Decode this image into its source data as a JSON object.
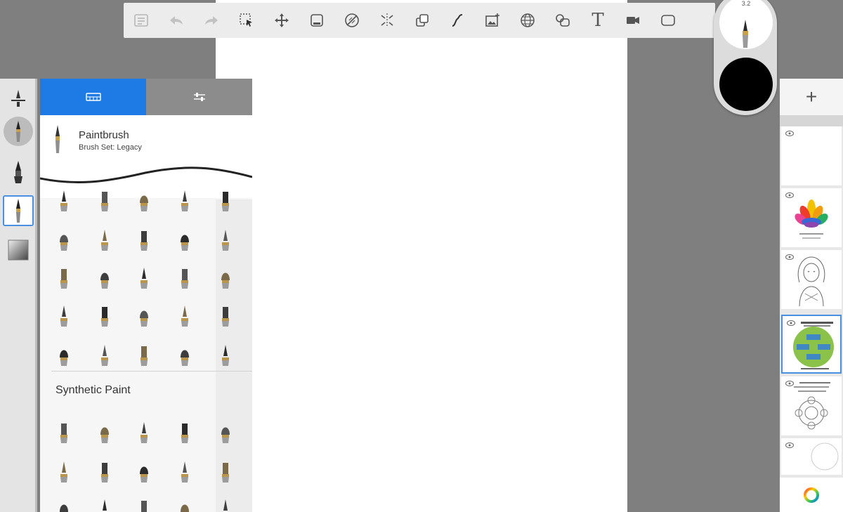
{
  "toolbar": {
    "tools": [
      {
        "id": "lagoon",
        "name": "lagoon-icon",
        "enabled": false
      },
      {
        "id": "undo",
        "name": "undo-icon",
        "enabled": false
      },
      {
        "id": "redo",
        "name": "redo-icon",
        "enabled": false
      },
      {
        "id": "select",
        "name": "selection-icon",
        "enabled": true
      },
      {
        "id": "transform",
        "name": "transform-icon",
        "enabled": true
      },
      {
        "id": "crop",
        "name": "crop-icon",
        "enabled": true
      },
      {
        "id": "ruler",
        "name": "ruler-icon",
        "enabled": true
      },
      {
        "id": "symmetry",
        "name": "symmetry-icon",
        "enabled": true
      },
      {
        "id": "fill",
        "name": "fill-icon",
        "enabled": true
      },
      {
        "id": "curve",
        "name": "curve-icon",
        "enabled": true
      },
      {
        "id": "image",
        "name": "add-image-icon",
        "enabled": true
      },
      {
        "id": "perspective",
        "name": "perspective-guide-icon",
        "enabled": true
      },
      {
        "id": "stamp",
        "name": "stamp-icon",
        "enabled": true
      },
      {
        "id": "text",
        "name": "text-icon",
        "enabled": true,
        "glyph": "T"
      },
      {
        "id": "record",
        "name": "time-lapse-icon",
        "enabled": true
      },
      {
        "id": "fullscreen",
        "name": "fullscreen-icon",
        "enabled": true
      }
    ]
  },
  "puck": {
    "brush_size": "3.2",
    "color": "#000000"
  },
  "brush_panel": {
    "active_tab": "library",
    "brush_name": "Paintbrush",
    "brush_set": "Brush Set: Legacy",
    "section_title": "Synthetic Paint"
  },
  "layers": {
    "add_label": "+",
    "count": 6,
    "selected_index": 3
  },
  "colors": {
    "accent": "#1e7be6",
    "canvas": "#ffffff",
    "background": "#7f7f7f"
  }
}
